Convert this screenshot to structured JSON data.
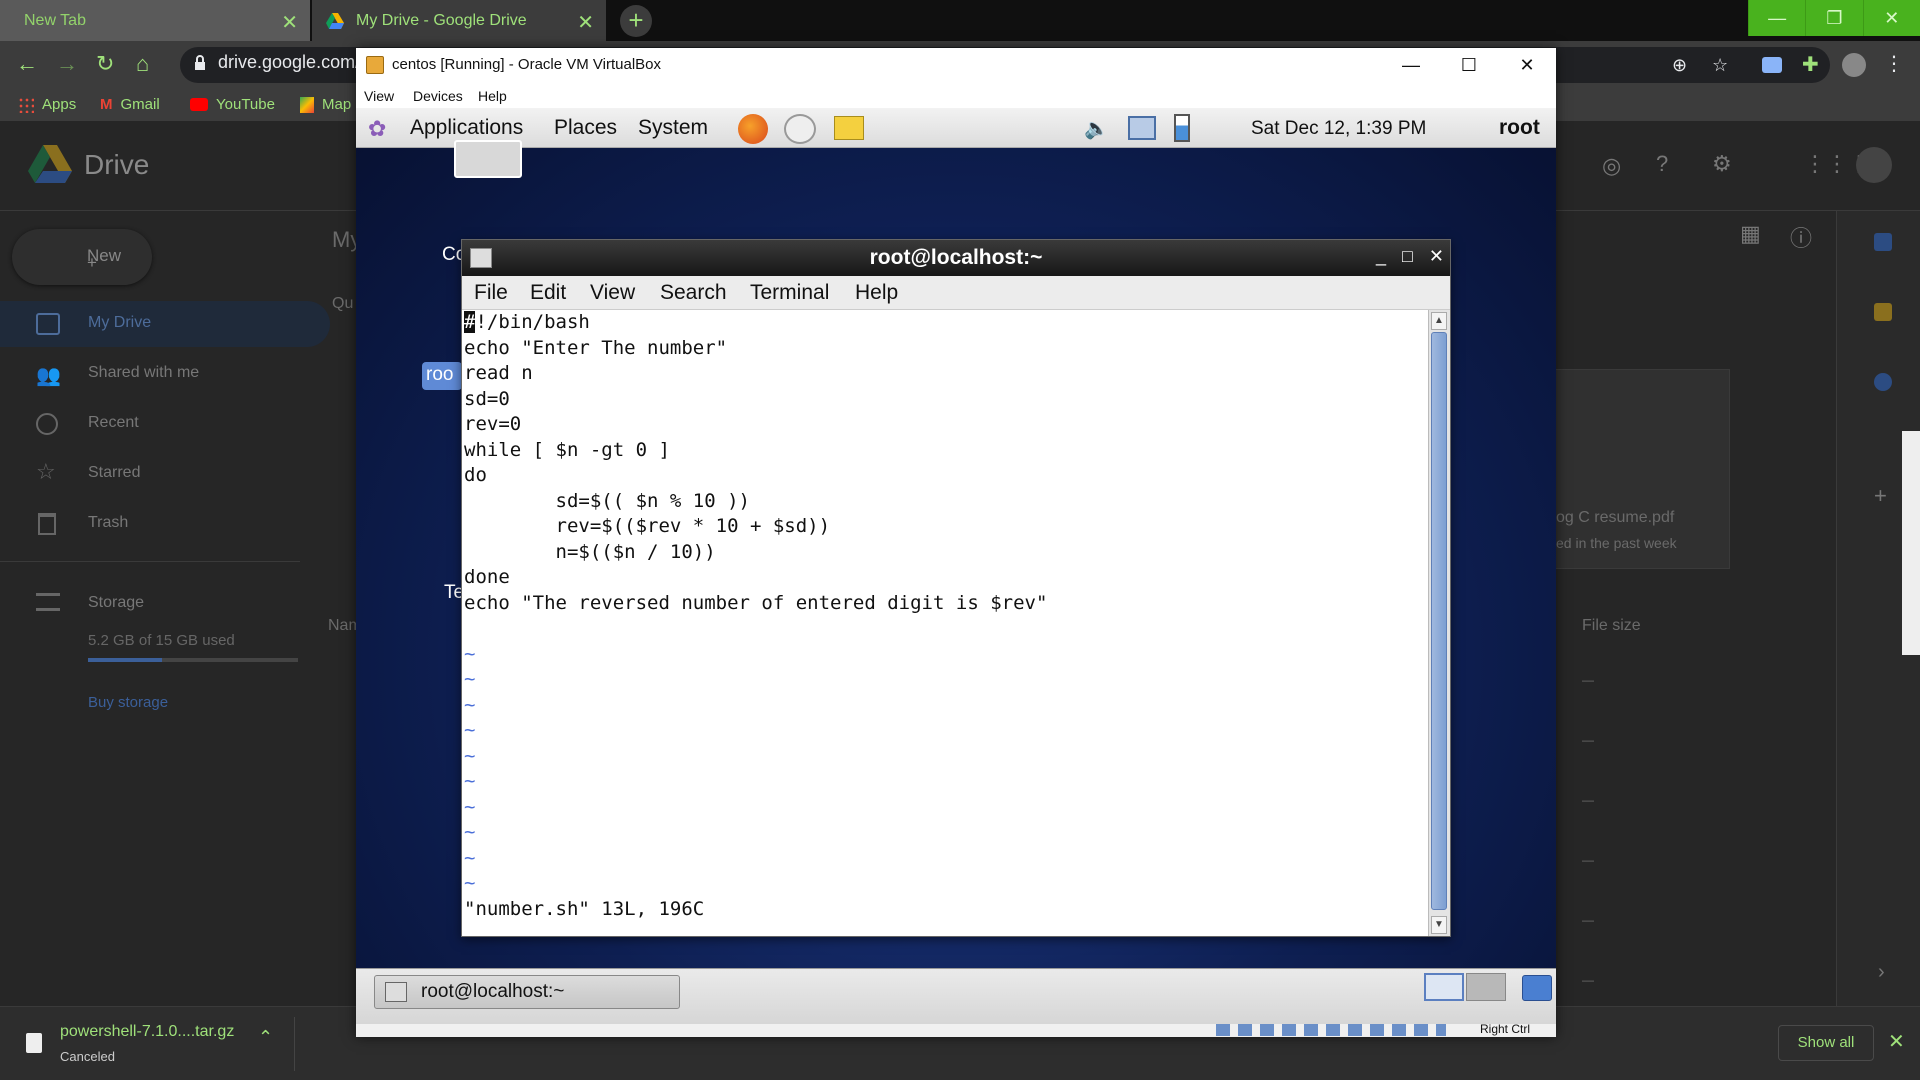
{
  "browser": {
    "tabs": [
      {
        "label": "New Tab"
      },
      {
        "label": "My Drive - Google Drive"
      }
    ],
    "url": "drive.google.com/",
    "bookmarks": [
      "Apps",
      "Gmail",
      "YouTube",
      "Map"
    ]
  },
  "drive": {
    "logo_text": "Drive",
    "new_label": "New",
    "header_partial": "My",
    "quick_partial": "Qu",
    "sidebar": [
      {
        "label": "My Drive",
        "icon": "drive-icon"
      },
      {
        "label": "Shared with me",
        "icon": "people-icon"
      },
      {
        "label": "Recent",
        "icon": "clock-icon"
      },
      {
        "label": "Starred",
        "icon": "star-icon"
      },
      {
        "label": "Trash",
        "icon": "trash-icon"
      }
    ],
    "storage_label": "Storage",
    "storage_used": "5.2 GB of 15 GB used",
    "storage_fraction": 0.35,
    "buy_storage": "Buy storage",
    "name_col_partial": "Nam",
    "file_size_col": "File size",
    "quick_file_name": "og C resume.pdf",
    "quick_file_sub": "ed in the past week",
    "row_dash": "—"
  },
  "download": {
    "filename": "powershell-7.1.0....tar.gz",
    "status": "Canceled",
    "show_all": "Show all"
  },
  "vbox": {
    "title": "centos [Running] - Oracle VM VirtualBox",
    "menu": [
      "View",
      "Devices",
      "Help"
    ],
    "status_key": "Right Ctrl"
  },
  "guest": {
    "panel_menus": [
      "Applications",
      "Places",
      "System"
    ],
    "clock": "Sat Dec 12,  1:39 PM",
    "user": "root",
    "desktop_label_1": "Co",
    "desktop_selected": "roo",
    "desktop_label_2": "Te",
    "taskbar_item": "root@localhost:~"
  },
  "terminal": {
    "title": "root@localhost:~",
    "menu": [
      "File",
      "Edit",
      "View",
      "Search",
      "Terminal",
      "Help"
    ],
    "cursor_char": "#",
    "first_line_rest": "!/bin/bash",
    "lines": [
      "echo \"Enter The number\"",
      "read n",
      "sd=0",
      "rev=0",
      "while [ $n -gt 0 ]",
      "do",
      "        sd=$(( $n % 10 ))",
      "        rev=$(($rev * 10 + $sd))",
      "        n=$(($n / 10))",
      "done",
      "echo \"The reversed number of entered digit is $rev\"",
      "",
      "~",
      "~",
      "~",
      "~",
      "~",
      "~",
      "~",
      "~",
      "~",
      "~"
    ],
    "status_line": "\"number.sh\" 13L, 196C"
  }
}
